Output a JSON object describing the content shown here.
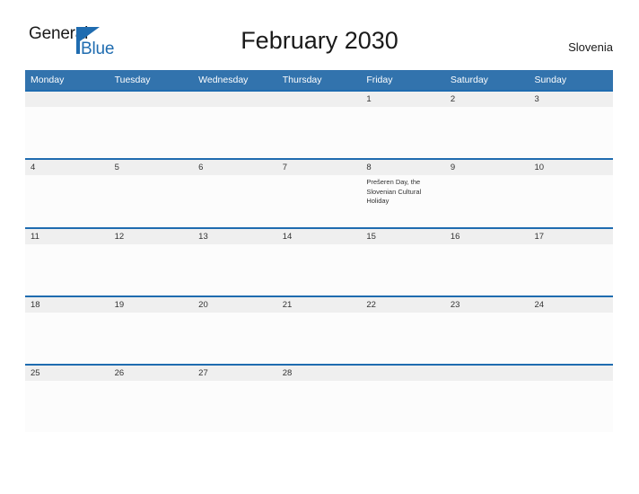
{
  "brand": {
    "name_part1": "General",
    "name_part2": "Blue",
    "triangle_icon": "triangle-logo-icon",
    "accent_color": "#1f6cb0"
  },
  "header": {
    "title": "February 2030",
    "country": "Slovenia"
  },
  "calendar": {
    "header_bg": "#3273ad",
    "date_band_bg": "#efefef",
    "rule_color": "#1f6cb0",
    "weekdays": [
      "Monday",
      "Tuesday",
      "Wednesday",
      "Thursday",
      "Friday",
      "Saturday",
      "Sunday"
    ],
    "weeks": [
      {
        "days": [
          {
            "num": "",
            "event": ""
          },
          {
            "num": "",
            "event": ""
          },
          {
            "num": "",
            "event": ""
          },
          {
            "num": "",
            "event": ""
          },
          {
            "num": "1",
            "event": ""
          },
          {
            "num": "2",
            "event": ""
          },
          {
            "num": "3",
            "event": ""
          }
        ]
      },
      {
        "days": [
          {
            "num": "4",
            "event": ""
          },
          {
            "num": "5",
            "event": ""
          },
          {
            "num": "6",
            "event": ""
          },
          {
            "num": "7",
            "event": ""
          },
          {
            "num": "8",
            "event": "Prešeren Day, the Slovenian Cultural Holiday"
          },
          {
            "num": "9",
            "event": ""
          },
          {
            "num": "10",
            "event": ""
          }
        ]
      },
      {
        "days": [
          {
            "num": "11",
            "event": ""
          },
          {
            "num": "12",
            "event": ""
          },
          {
            "num": "13",
            "event": ""
          },
          {
            "num": "14",
            "event": ""
          },
          {
            "num": "15",
            "event": ""
          },
          {
            "num": "16",
            "event": ""
          },
          {
            "num": "17",
            "event": ""
          }
        ]
      },
      {
        "days": [
          {
            "num": "18",
            "event": ""
          },
          {
            "num": "19",
            "event": ""
          },
          {
            "num": "20",
            "event": ""
          },
          {
            "num": "21",
            "event": ""
          },
          {
            "num": "22",
            "event": ""
          },
          {
            "num": "23",
            "event": ""
          },
          {
            "num": "24",
            "event": ""
          }
        ]
      },
      {
        "days": [
          {
            "num": "25",
            "event": ""
          },
          {
            "num": "26",
            "event": ""
          },
          {
            "num": "27",
            "event": ""
          },
          {
            "num": "28",
            "event": ""
          },
          {
            "num": "",
            "event": ""
          },
          {
            "num": "",
            "event": ""
          },
          {
            "num": "",
            "event": ""
          }
        ]
      }
    ]
  }
}
